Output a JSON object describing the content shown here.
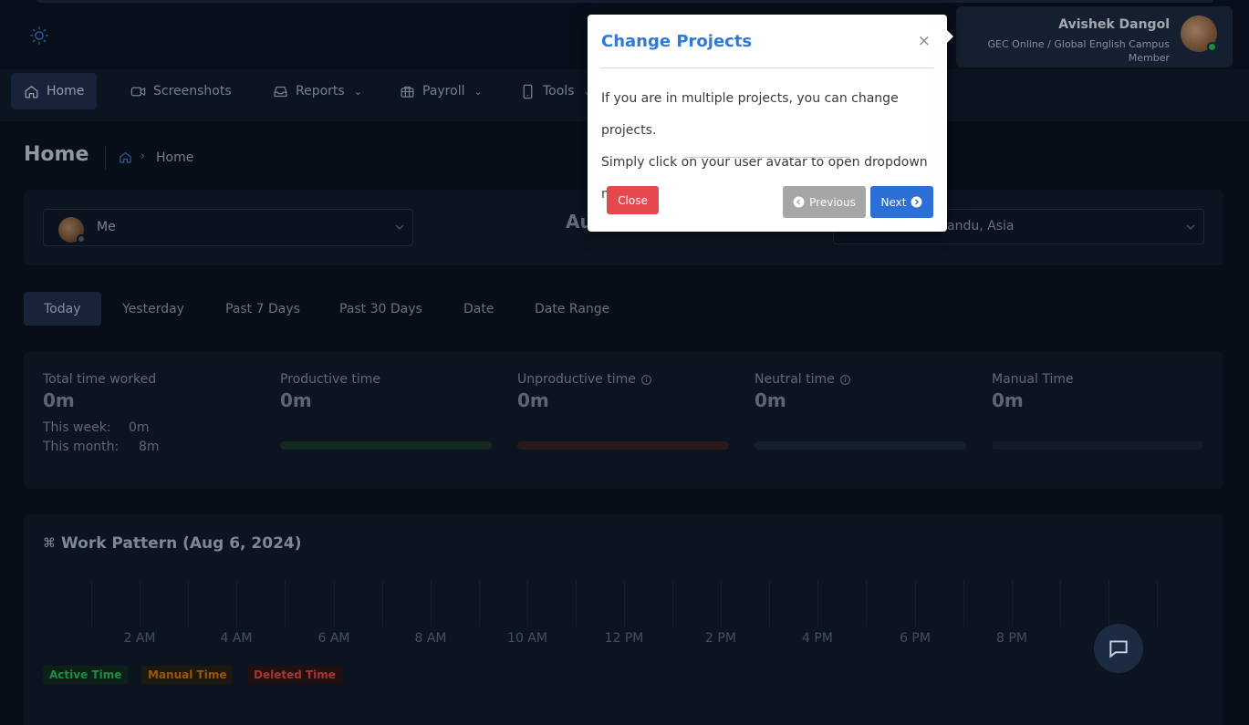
{
  "header": {
    "profile": {
      "name": "Avishek Dangol",
      "org": "GEC Online / Global English Campus",
      "role": "Member"
    }
  },
  "nav": {
    "items": [
      {
        "label": "Home",
        "icon": "home-icon"
      },
      {
        "label": "Screenshots",
        "icon": "video-icon"
      },
      {
        "label": "Reports",
        "icon": "reports-icon"
      },
      {
        "label": "Payroll",
        "icon": "briefcase-icon"
      },
      {
        "label": "Tools",
        "icon": "tablet-icon"
      }
    ]
  },
  "breadcrumb": {
    "title": "Home",
    "current": "Home"
  },
  "filters": {
    "user": "Me",
    "date_partial": "Au",
    "timezone_partial": "thmandu, Asia"
  },
  "periods": [
    "Today",
    "Yesterday",
    "Past 7 Days",
    "Past 30 Days",
    "Date",
    "Date Range"
  ],
  "stats": {
    "total": {
      "label": "Total time worked",
      "value": "0m"
    },
    "productive": {
      "label": "Productive time",
      "value": "0m"
    },
    "unproductive": {
      "label": "Unproductive time",
      "value": "0m"
    },
    "neutral": {
      "label": "Neutral time",
      "value": "0m"
    },
    "manual": {
      "label": "Manual Time",
      "value": "0m"
    },
    "this_week_label": "This week:",
    "this_week_value": "0m",
    "this_month_label": "This month:",
    "this_month_value": "8m"
  },
  "pattern": {
    "title": "Work Pattern (Aug 6, 2024)",
    "hour_labels": [
      "2 AM",
      "4 AM",
      "6 AM",
      "8 AM",
      "10 AM",
      "12 PM",
      "2 PM",
      "4 PM",
      "6 PM",
      "8 PM",
      "M"
    ],
    "legend": {
      "active": "Active Time",
      "manual": "Manual Time",
      "deleted": "Deleted Time"
    }
  },
  "modal": {
    "title": "Change Projects",
    "close_x": "×",
    "line1": "If you are in multiple projects, you can change projects.",
    "line2": "Simply click on your user avatar to open dropdown menu.",
    "close_label": "Close",
    "prev_label": "Previous",
    "next_label": "Next"
  },
  "colors": {
    "accent": "#2f7ad8",
    "productive_bar": "#1d3a2c",
    "unproductive_bar": "#3a2424",
    "neutral_bar": "#1e2a3c",
    "manual_bar": "#1b2638",
    "active_legend": "#22c55e",
    "manual_legend": "#d97706",
    "deleted_legend": "#ef4444"
  }
}
